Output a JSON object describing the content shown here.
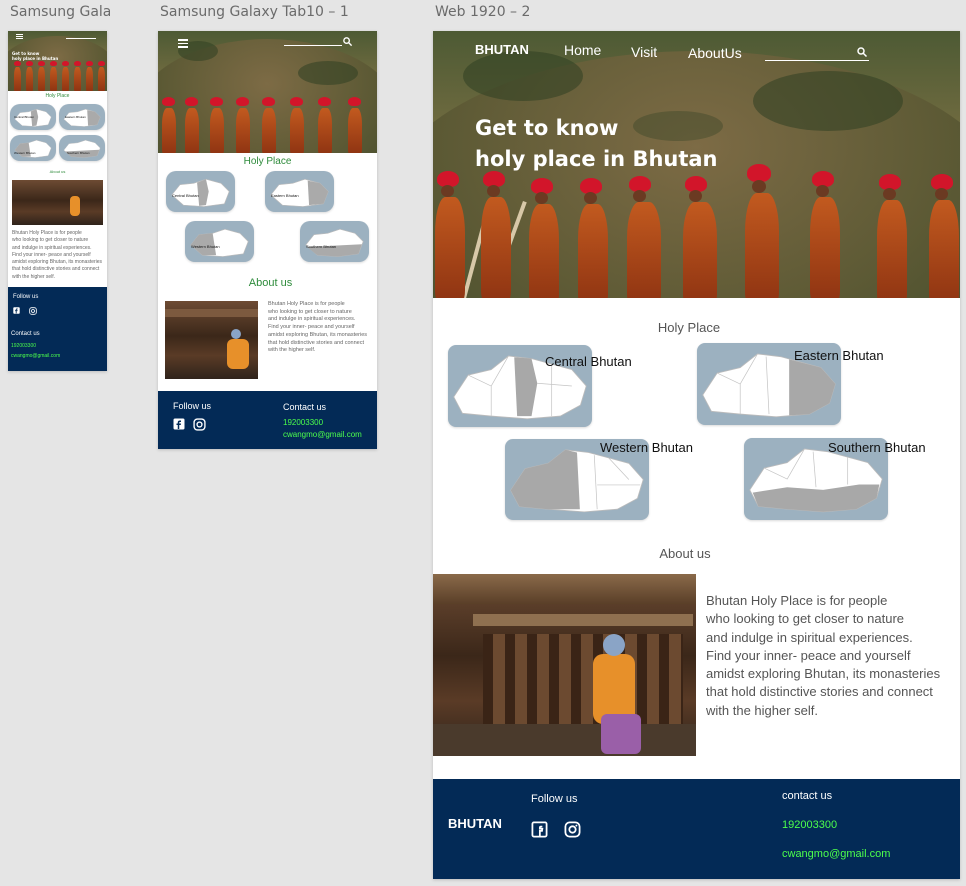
{
  "artboards": {
    "phone": {
      "title": "Samsung Gala..."
    },
    "tablet": {
      "title": "Samsung Galaxy Tab10 – 1"
    },
    "web": {
      "title": "Web 1920 – 2"
    }
  },
  "brand": "BHUTAN",
  "nav": {
    "home": "Home",
    "visit": "Visit",
    "about": "AboutUs"
  },
  "hero": {
    "line1": "Get to know",
    "line2": "holy place in Bhutan",
    "phone_line1": "Get to know",
    "phone_line2": "holy place in Bhutan"
  },
  "holy_place": {
    "title": "Holy Place",
    "regions": [
      {
        "label": "Central Bhutan",
        "short": "Central Bhutan"
      },
      {
        "label": "Eastern Bhutan",
        "short": "Eastern Bhutan"
      },
      {
        "label": "Western Bhutan",
        "short": "Western Bhutan"
      },
      {
        "label": "Southern Bhutan",
        "short": "Southern Bhutan"
      }
    ]
  },
  "about": {
    "title": "About us",
    "text": "Bhutan Holy Place is for people\nwho looking to get closer to nature\nand indulge in spiritual experiences.\nFind your inner- peace and yourself\namidst exploring Bhutan, its monasteries\nthat hold distinctive stories and connect\nwith the higher self."
  },
  "footer": {
    "brand": "BHUTAN",
    "follow": "Follow us",
    "contact_web": "contact us",
    "contact_mobile": "Contact us",
    "phone": "192003300",
    "email": "cwangmo@gmail.com"
  },
  "colors": {
    "footer_bg": "#032a56",
    "accent_green": "#4cff4c",
    "heading_green": "#2e8b3b",
    "map_bg": "#9cb1c0",
    "monk_robe": "#c25a1f",
    "monk_hat": "#d2152a"
  },
  "icons": [
    "hamburger-icon",
    "search-icon",
    "facebook-icon",
    "instagram-icon"
  ]
}
